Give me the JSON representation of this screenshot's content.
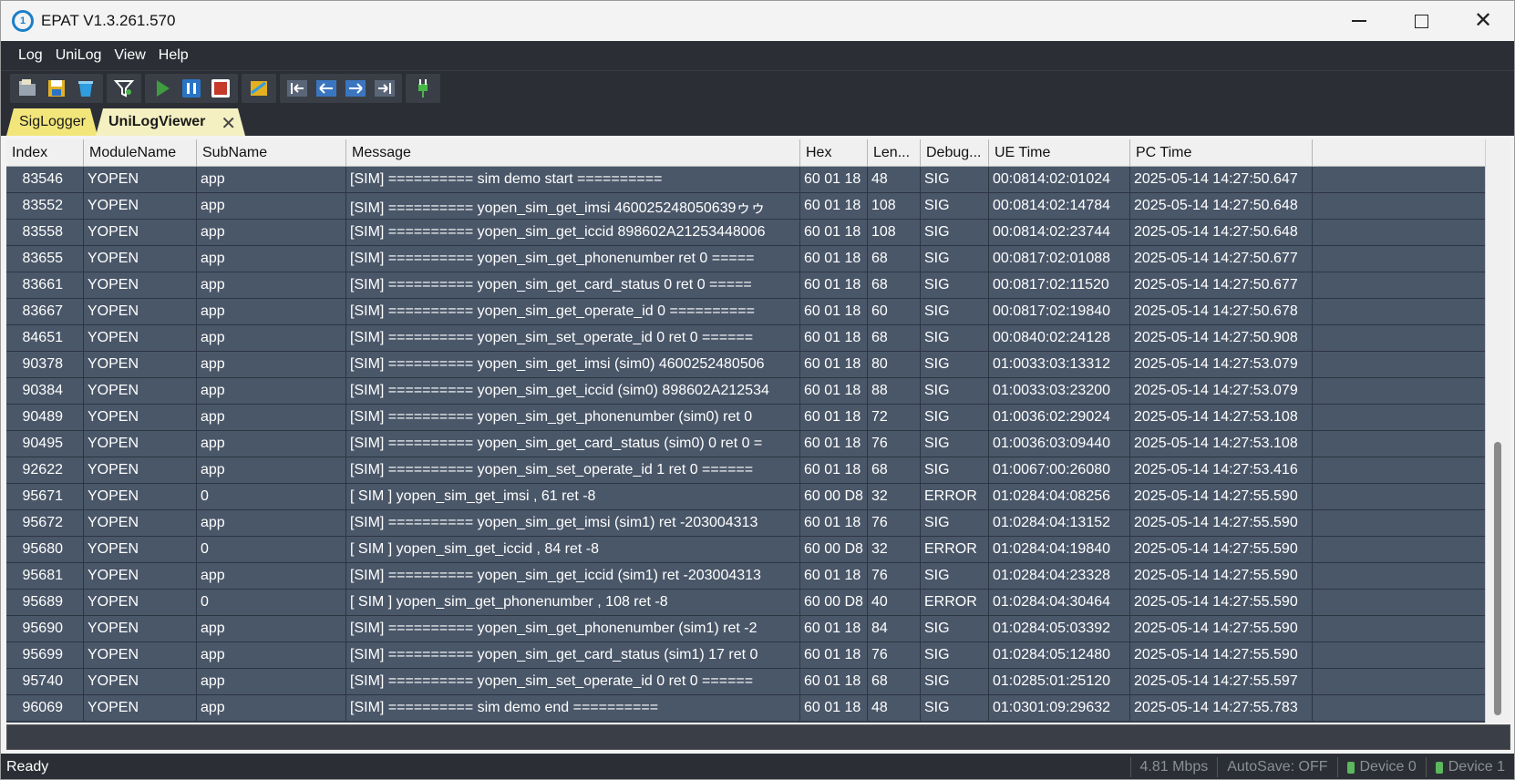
{
  "window": {
    "title": "EPAT V1.3.261.570"
  },
  "menu": [
    "Log",
    "UniLog",
    "View",
    "Help"
  ],
  "toolbar": {
    "groups": [
      [
        "open-folder-icon",
        "save-icon",
        "clear-icon"
      ],
      [
        "filter-icon"
      ],
      [
        "play-icon",
        "pause-icon",
        "stop-icon"
      ],
      [
        "database-icon"
      ],
      [
        "first-icon",
        "prev-icon",
        "next-icon",
        "last-icon"
      ],
      [
        "plug-icon"
      ]
    ],
    "colors": {
      "play": "#3f9c3f",
      "pause": "#2a74c8",
      "stop": "#c53a2b",
      "nav": "#3a76c0",
      "plug": "#49b649"
    }
  },
  "tabs": [
    {
      "label": "SigLogger",
      "active": false
    },
    {
      "label": "UniLogViewer",
      "active": true
    }
  ],
  "grid": {
    "columns": [
      "Index",
      "ModuleName",
      "SubName",
      "Message",
      "Hex",
      "Len...",
      "Debug...",
      "UE Time",
      "PC Time"
    ],
    "rows": [
      [
        "83546",
        "YOPEN",
        "app",
        "[SIM] ========== sim demo start ==========",
        "60 01 18",
        "48",
        "SIG",
        "00:0814:02:01024",
        "2025-05-14 14:27:50.647"
      ],
      [
        "83552",
        "YOPEN",
        "app",
        "[SIM] ========== yopen_sim_get_imsi 460025248050639ゥゥ",
        "60 01 18",
        "108",
        "SIG",
        "00:0814:02:14784",
        "2025-05-14 14:27:50.648"
      ],
      [
        "83558",
        "YOPEN",
        "app",
        "[SIM] ========== yopen_sim_get_iccid 898602A21253448006",
        "60 01 18",
        "108",
        "SIG",
        "00:0814:02:23744",
        "2025-05-14 14:27:50.648"
      ],
      [
        "83655",
        "YOPEN",
        "app",
        "[SIM] ========== yopen_sim_get_phonenumber  ret 0 =====",
        "60 01 18",
        "68",
        "SIG",
        "00:0817:02:01088",
        "2025-05-14 14:27:50.677"
      ],
      [
        "83661",
        "YOPEN",
        "app",
        "[SIM] ========== yopen_sim_get_card_status 0 ret 0 =====",
        "60 01 18",
        "68",
        "SIG",
        "00:0817:02:11520",
        "2025-05-14 14:27:50.677"
      ],
      [
        "83667",
        "YOPEN",
        "app",
        "[SIM] ========== yopen_sim_get_operate_id 0  ==========",
        "60 01 18",
        "60",
        "SIG",
        "00:0817:02:19840",
        "2025-05-14 14:27:50.678"
      ],
      [
        "84651",
        "YOPEN",
        "app",
        "[SIM] ========== yopen_sim_set_operate_id 0 ret 0  ======",
        "60 01 18",
        "68",
        "SIG",
        "00:0840:02:24128",
        "2025-05-14 14:27:50.908"
      ],
      [
        "90378",
        "YOPEN",
        "app",
        "[SIM] ========== yopen_sim_get_imsi (sim0) 4600252480506",
        "60 01 18",
        "80",
        "SIG",
        "01:0033:03:13312",
        "2025-05-14 14:27:53.079"
      ],
      [
        "90384",
        "YOPEN",
        "app",
        "[SIM] ========== yopen_sim_get_iccid (sim0) 898602A212534",
        "60 01 18",
        "88",
        "SIG",
        "01:0033:03:23200",
        "2025-05-14 14:27:53.079"
      ],
      [
        "90489",
        "YOPEN",
        "app",
        "[SIM] ========== yopen_sim_get_phonenumber (sim0)  ret 0",
        "60 01 18",
        "72",
        "SIG",
        "01:0036:02:29024",
        "2025-05-14 14:27:53.108"
      ],
      [
        "90495",
        "YOPEN",
        "app",
        "[SIM] ========== yopen_sim_get_card_status (sim0) 0 ret 0 =",
        "60 01 18",
        "76",
        "SIG",
        "01:0036:03:09440",
        "2025-05-14 14:27:53.108"
      ],
      [
        "92622",
        "YOPEN",
        "app",
        "[SIM] ========== yopen_sim_set_operate_id 1 ret 0  ======",
        "60 01 18",
        "68",
        "SIG",
        "01:0067:00:26080",
        "2025-05-14 14:27:53.416"
      ],
      [
        "95671",
        "YOPEN",
        "0",
        "[ SIM ] yopen_sim_get_imsi , 61 ret -8",
        "60 00 D8",
        "32",
        "ERROR",
        "01:0284:04:08256",
        "2025-05-14 14:27:55.590"
      ],
      [
        "95672",
        "YOPEN",
        "app",
        "[SIM] ========== yopen_sim_get_imsi (sim1)  ret -203004313",
        "60 01 18",
        "76",
        "SIG",
        "01:0284:04:13152",
        "2025-05-14 14:27:55.590"
      ],
      [
        "95680",
        "YOPEN",
        "0",
        "[ SIM ] yopen_sim_get_iccid , 84 ret -8",
        "60 00 D8",
        "32",
        "ERROR",
        "01:0284:04:19840",
        "2025-05-14 14:27:55.590"
      ],
      [
        "95681",
        "YOPEN",
        "app",
        "[SIM] ========== yopen_sim_get_iccid (sim1)  ret -203004313",
        "60 01 18",
        "76",
        "SIG",
        "01:0284:04:23328",
        "2025-05-14 14:27:55.590"
      ],
      [
        "95689",
        "YOPEN",
        "0",
        "[ SIM ] yopen_sim_get_phonenumber , 108 ret -8",
        "60 00 D8",
        "40",
        "ERROR",
        "01:0284:04:30464",
        "2025-05-14 14:27:55.590"
      ],
      [
        "95690",
        "YOPEN",
        "app",
        "[SIM] ========== yopen_sim_get_phonenumber (sim1)  ret -2",
        "60 01 18",
        "84",
        "SIG",
        "01:0284:05:03392",
        "2025-05-14 14:27:55.590"
      ],
      [
        "95699",
        "YOPEN",
        "app",
        "[SIM] ========== yopen_sim_get_card_status (sim1) 17 ret 0",
        "60 01 18",
        "76",
        "SIG",
        "01:0284:05:12480",
        "2025-05-14 14:27:55.590"
      ],
      [
        "95740",
        "YOPEN",
        "app",
        "[SIM] ========== yopen_sim_set_operate_id 0 ret 0  ======",
        "60 01 18",
        "68",
        "SIG",
        "01:0285:01:25120",
        "2025-05-14 14:27:55.597"
      ],
      [
        "96069",
        "YOPEN",
        "app",
        "[SIM] ========== sim demo end ==========",
        "60 01 18",
        "48",
        "SIG",
        "01:0301:09:29632",
        "2025-05-14 14:27:55.783"
      ]
    ]
  },
  "status": {
    "ready": "Ready",
    "speed": "4.81 Mbps",
    "autosave": "AutoSave: OFF",
    "device0": "Device 0",
    "device1": "Device 1"
  }
}
